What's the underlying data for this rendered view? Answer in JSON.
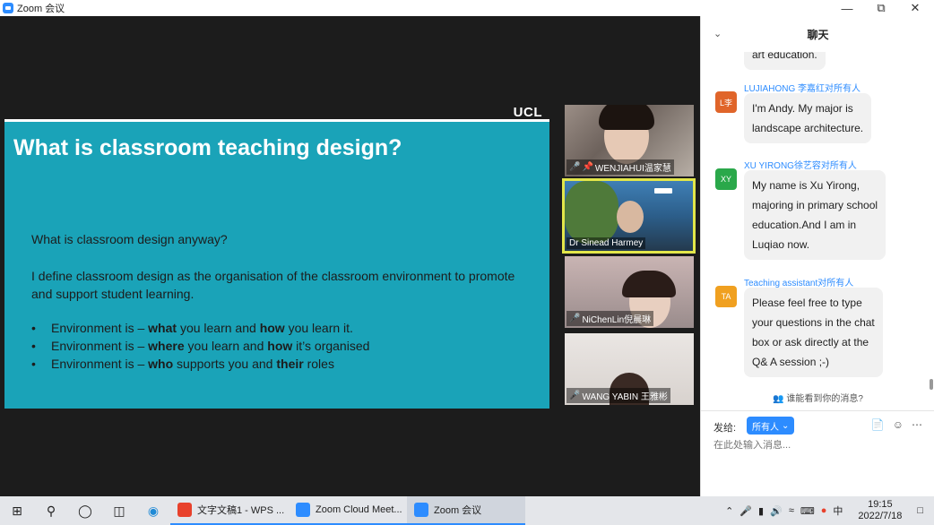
{
  "window": {
    "title": "Zoom 会议"
  },
  "slide": {
    "logo": "UCL",
    "title": "What is classroom teaching design?",
    "question": "What is classroom design anyway?",
    "definition": "I define classroom design as the organisation of the classroom environment to promote and support student learning.",
    "bullets": [
      {
        "pre": "Environment is – ",
        "b1": "what",
        "mid": " you learn and ",
        "b2": "how",
        "post": " you learn it."
      },
      {
        "pre": "Environment is – ",
        "b1": "where",
        "mid": " you learn and ",
        "b2": "how",
        "post": " it’s organised"
      },
      {
        "pre": "Environment is – ",
        "b1": "who",
        "mid": " supports you and ",
        "b2": "their",
        "post": " roles"
      }
    ]
  },
  "participants": [
    {
      "name": "WENJIAHUI温家慧",
      "muted": true,
      "pinned": true
    },
    {
      "name": "Dr Sinead Harmey",
      "muted": false,
      "active": true
    },
    {
      "name": "NiChenLin倪晨琳",
      "muted": true
    },
    {
      "name": "WANG YABIN 王雅彬",
      "muted": true
    }
  ],
  "chat": {
    "title": "聊天",
    "prev_fragment": "art education.",
    "messages": [
      {
        "initials": "L李",
        "avatar_color": "#e0652a",
        "sender": "LUJIAHONG 李嘉红对所有人",
        "lines": [
          "I'm Andy. My major is",
          "landscape architecture."
        ]
      },
      {
        "initials": "XY",
        "avatar_color": "#2aa84a",
        "sender": "XU YIRONG徐艺容对所有人",
        "lines": [
          "My name is Xu Yirong,",
          "majoring in primary school",
          "education.And I am in",
          "Luqiao now."
        ]
      },
      {
        "initials": "TA",
        "avatar_color": "#f0a020",
        "sender": "Teaching assistant对所有人",
        "lines": [
          "Please feel free to type",
          "your questions in the chat",
          "box or ask directly at the",
          "Q& A session ;-)"
        ]
      }
    ],
    "who_sees": "谁能看到你的消息?",
    "to_label": "发给:",
    "to_value": "所有人",
    "input_placeholder": "在此处输入消息..."
  },
  "taskbar": {
    "apps": [
      {
        "label": "文字文稿1 - WPS ...",
        "color": "#e8412c"
      },
      {
        "label": "Zoom Cloud Meet...",
        "color": "#2d8cff"
      },
      {
        "label": "Zoom 会议",
        "color": "#2d8cff",
        "active": true
      }
    ],
    "time": "19:15",
    "date": "2022/7/18"
  }
}
